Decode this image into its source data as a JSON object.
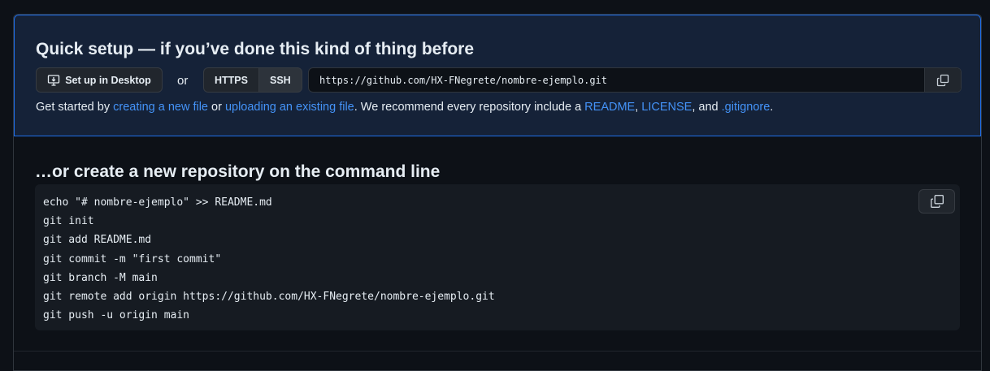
{
  "quick_setup": {
    "title": "Quick setup — if you’ve done this kind of thing before",
    "desktop_button_label": "Set up in Desktop",
    "or_label": "or",
    "protocols": [
      "HTTPS",
      "SSH"
    ],
    "selected_protocol": "HTTPS",
    "clone_url": "https://github.com/HX-FNegrete/nombre-ejemplo.git",
    "help": {
      "prefix": "Get started by ",
      "link_new_file": "creating a new file",
      "mid1": " or ",
      "link_upload": "uploading an existing file",
      "mid2": ". We recommend every repository include a ",
      "link_readme": "README",
      "sep1": ", ",
      "link_license": "LICENSE",
      "sep2": ", and ",
      "link_gitignore": ".gitignore",
      "suffix": "."
    }
  },
  "command_line": {
    "title": "…or create a new repository on the command line",
    "lines": [
      "echo \"# nombre-ejemplo\" >> README.md",
      "git init",
      "git add README.md",
      "git commit -m \"first commit\"",
      "git branch -M main",
      "git remote add origin https://github.com/HX-FNegrete/nombre-ejemplo.git",
      "git push -u origin main"
    ]
  },
  "icons": {
    "desktop": "desktop-download-icon",
    "copy": "copy-icon"
  },
  "colors": {
    "background": "#0d1117",
    "quick_setup_bg": "#152238",
    "accent_border": "#1f6feb",
    "link": "#4493f8",
    "code_bg": "#161b22"
  }
}
